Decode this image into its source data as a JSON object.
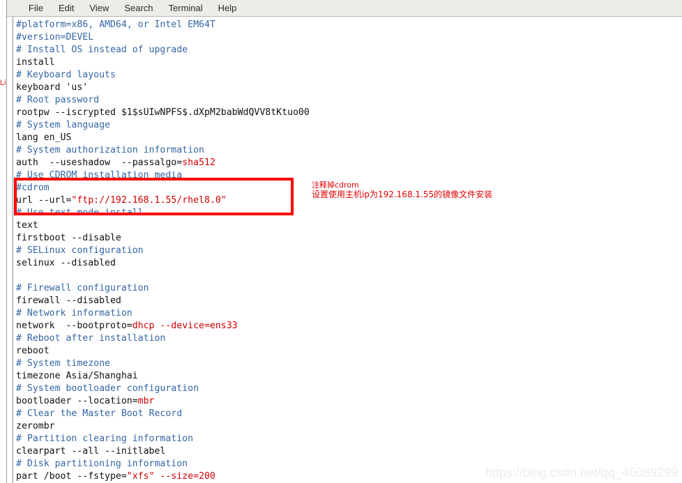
{
  "window": {
    "title": "Terminal",
    "background_fragment_text": "Lin"
  },
  "menubar": {
    "items": [
      {
        "label": "File"
      },
      {
        "label": "Edit"
      },
      {
        "label": "View"
      },
      {
        "label": "Search"
      },
      {
        "label": "Terminal"
      },
      {
        "label": "Help"
      }
    ]
  },
  "editor": {
    "file_kind": "kickstart-config",
    "lines": [
      {
        "text": "#platform=x86, AMD64, or Intel EM64T",
        "style": "comment"
      },
      {
        "text": "#version=DEVEL",
        "style": "comment"
      },
      {
        "text": "# Install OS instead of upgrade",
        "style": "comment"
      },
      {
        "text": "install",
        "style": "plain"
      },
      {
        "text": "# Keyboard layouts",
        "style": "comment"
      },
      {
        "text": "keyboard 'us'",
        "style": "plain"
      },
      {
        "text": "# Root password",
        "style": "comment"
      },
      {
        "text": "rootpw --iscrypted $1$sUIwNPFS$.dXpM2babWdQVV8tKtuo00",
        "style": "plain"
      },
      {
        "text": "# System language",
        "style": "comment"
      },
      {
        "text": "lang en_US",
        "style": "plain"
      },
      {
        "text": "# System authorization information",
        "style": "comment"
      },
      {
        "text": "auth  --useshadow  --passalgo=",
        "style": "plain",
        "tail": "sha512",
        "tail_style": "red"
      },
      {
        "text": "# Use CDROM installation media",
        "style": "comment"
      },
      {
        "text": "#cdrom",
        "style": "comment"
      },
      {
        "text": "url --url=",
        "style": "plain",
        "tail": "\"ftp://192.168.1.55/rhel8.0\"",
        "tail_style": "red"
      },
      {
        "text": "# Use text mode install",
        "style": "comment"
      },
      {
        "text": "text",
        "style": "plain"
      },
      {
        "text": "firstboot --disable",
        "style": "plain"
      },
      {
        "text": "# SELinux configuration",
        "style": "comment"
      },
      {
        "text": "selinux --disabled",
        "style": "plain"
      },
      {
        "text": "",
        "style": "plain"
      },
      {
        "text": "# Firewall configuration",
        "style": "comment"
      },
      {
        "text": "firewall --disabled",
        "style": "plain"
      },
      {
        "text": "# Network information",
        "style": "comment"
      },
      {
        "text": "network  --bootproto=",
        "style": "plain",
        "tail": "dhcp --device=ens33",
        "tail_style": "red"
      },
      {
        "text": "# Reboot after installation",
        "style": "comment"
      },
      {
        "text": "reboot",
        "style": "plain"
      },
      {
        "text": "# System timezone",
        "style": "comment"
      },
      {
        "text": "timezone Asia/Shanghai",
        "style": "plain"
      },
      {
        "text": "# System bootloader configuration",
        "style": "comment"
      },
      {
        "text": "bootloader --location=",
        "style": "plain",
        "tail": "mbr",
        "tail_style": "red"
      },
      {
        "text": "# Clear the Master Boot Record",
        "style": "comment"
      },
      {
        "text": "zerombr",
        "style": "plain"
      },
      {
        "text": "# Partition clearing information",
        "style": "comment"
      },
      {
        "text": "clearpart --all --initlabel",
        "style": "plain"
      },
      {
        "text": "# Disk partitioning information",
        "style": "comment"
      },
      {
        "text": "part /boot --fstype=",
        "style": "plain",
        "tail": "\"xfs\" --size=200",
        "tail_style": "red"
      }
    ]
  },
  "annotation": {
    "line1": "注释掉cdrom",
    "line2": "设置使用主机ip为192.168.1.55的镜像文件安装",
    "color": "#e00000"
  },
  "highlight_box": {
    "color": "#ff0000",
    "encloses": [
      "#cdrom",
      "url --url=\"ftp://192.168.1.55/rhel8.0\""
    ]
  },
  "watermark": {
    "text": "https://blog.csdn.net/qq_46089299"
  },
  "colors": {
    "comment": "#3465a4",
    "plain": "#111111",
    "red": "#d00000",
    "menubar_bg": "#edece9",
    "page_bg": "#ffffff"
  }
}
